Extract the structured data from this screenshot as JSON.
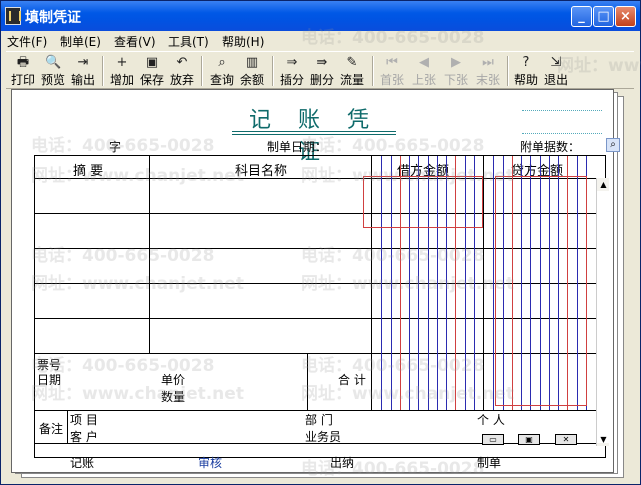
{
  "window": {
    "title": "填制凭证",
    "controls": {
      "minimize": "_",
      "maximize": "□",
      "close": "×"
    }
  },
  "menu": {
    "items": [
      "文件(F)",
      "制单(E)",
      "查看(V)",
      "工具(T)",
      "帮助(H)"
    ]
  },
  "toolbar": {
    "buttons": [
      {
        "label": "打印",
        "icon": "printer-icon",
        "glyph": "🖶",
        "enabled": true
      },
      {
        "label": "预览",
        "icon": "preview-icon",
        "glyph": "🔍",
        "enabled": true
      },
      {
        "label": "输出",
        "icon": "export-icon",
        "glyph": "⇥",
        "enabled": true
      },
      {
        "label": "增加",
        "icon": "add-icon",
        "glyph": "+",
        "enabled": true
      },
      {
        "label": "保存",
        "icon": "save-icon",
        "glyph": "▣",
        "enabled": true
      },
      {
        "label": "放弃",
        "icon": "undo-icon",
        "glyph": "↶",
        "enabled": true
      },
      {
        "label": "查询",
        "icon": "binoculars-icon",
        "glyph": "⌕",
        "enabled": true
      },
      {
        "label": "余额",
        "icon": "balance-chart-icon",
        "glyph": "▥",
        "enabled": true
      },
      {
        "label": "插分",
        "icon": "insert-line-icon",
        "glyph": "⇒",
        "enabled": true
      },
      {
        "label": "删分",
        "icon": "delete-line-icon",
        "glyph": "⇛",
        "enabled": true
      },
      {
        "label": "流量",
        "icon": "cashflow-icon",
        "glyph": "✎",
        "enabled": true
      },
      {
        "label": "首张",
        "icon": "first-page-icon",
        "glyph": "⏮",
        "enabled": false
      },
      {
        "label": "上张",
        "icon": "prev-page-icon",
        "glyph": "◀",
        "enabled": false
      },
      {
        "label": "下张",
        "icon": "next-page-icon",
        "glyph": "▶",
        "enabled": false
      },
      {
        "label": "末张",
        "icon": "last-page-icon",
        "glyph": "⏭",
        "enabled": false
      },
      {
        "label": "帮助",
        "icon": "help-icon",
        "glyph": "?",
        "enabled": true
      },
      {
        "label": "退出",
        "icon": "exit-icon",
        "glyph": "⇲",
        "enabled": true
      }
    ]
  },
  "voucher": {
    "title": "记 账 凭 证",
    "word_label": "字",
    "date_label": "制单日期：",
    "attachments_label": "附单据数：",
    "columns": {
      "summary": "摘  要",
      "account": "科目名称",
      "debit": "借方金额",
      "credit": "贷方金额"
    },
    "bottom": {
      "ticket_no": "票号",
      "date": "日期",
      "unit_price": "单价",
      "quantity": "数量",
      "total": "合 计",
      "remark": "备注",
      "project": "项  目",
      "customer": "客  户",
      "department": "部  门",
      "salesperson": "业务员",
      "person": "个  人"
    },
    "footer": {
      "bookkeeper": "记账",
      "auditor": "审核",
      "cashier": "出纳",
      "preparer": "制单"
    },
    "mini_icons": [
      "card-icon",
      "id-card-icon",
      "tool-icon"
    ]
  },
  "watermark": {
    "phone": "电话：400-665-0028",
    "site": "网址：www.chanjet.net"
  },
  "colors": {
    "title_bar": "#0054e3",
    "voucher_title": "#0f6b6b",
    "grid_blue": "#2b2bb0",
    "grid_red": "#d04040"
  }
}
